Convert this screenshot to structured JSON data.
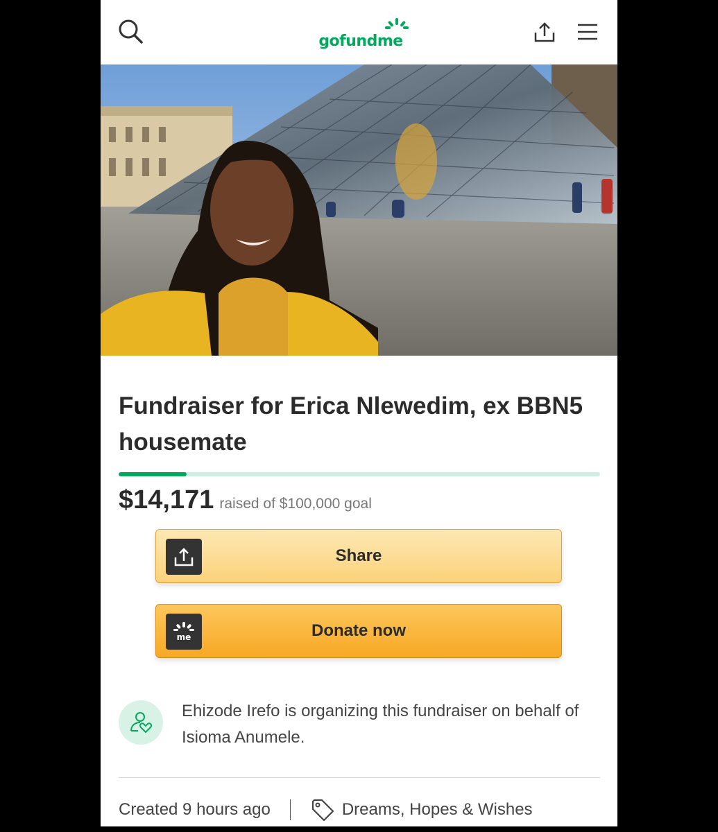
{
  "header": {
    "logo_text": "gofundme",
    "search_icon": "search-icon",
    "share_icon": "share-icon",
    "menu_icon": "menu-icon"
  },
  "hero": {
    "image": "hero-photo"
  },
  "campaign": {
    "title": "Fundraiser for Erica Nlewedim, ex BBN5 housemate",
    "raised": "$14,171",
    "goal_text": "raised of $100,000 goal",
    "progress": 0.14171
  },
  "buttons": {
    "share_label": "Share",
    "donate_label": "Donate now"
  },
  "organizer": {
    "text": "Ehizode Irefo is organizing this fundraiser on behalf of Isioma Anumele."
  },
  "meta": {
    "created": "Created 9 hours ago",
    "category": "Dreams, Hopes & Wishes"
  },
  "colors": {
    "brand_green": "#02a95c",
    "button_orange": "#f7a825",
    "button_light": "#fbd27a"
  }
}
